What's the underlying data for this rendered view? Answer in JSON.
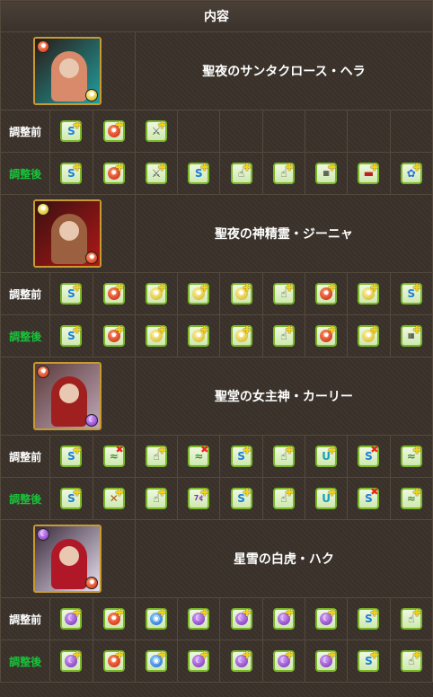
{
  "header": {
    "title": "内容"
  },
  "labels": {
    "before": "調整前",
    "after": "調整後"
  },
  "icon_legend": {
    "two-way": "two-way-attack-icon",
    "fire-orb": "fire-orb-enhance-icon",
    "light-orb": "light-orb-enhance-icon",
    "dark-orb": "dark-orb-enhance-icon",
    "water-orb": "water-orb-enhance-icon",
    "sword": "devil-killer-sword-icon",
    "finger": "time-extend-finger-icon",
    "skill": "skill-charge-icon",
    "bar": "bind-resist-icon",
    "heart": "heart-icon",
    "ribbon": "ribbon-icon",
    "shield": "combo-boost-icon",
    "wave": "seal-resist-icon",
    "slash": "resist-icon",
    "combo": "orb-count-icon"
  },
  "characters": [
    {
      "name": "聖夜のサンタクロース・ヘラ",
      "main_attr": "fire",
      "sub_attr": "light",
      "portrait_colors": [
        "#2a1a16",
        "#20a0a0",
        "#d88a6a"
      ],
      "before": [
        {
          "t": "two-way",
          "m": "plus"
        },
        {
          "t": "fire-orb",
          "m": "plus"
        },
        {
          "t": "sword",
          "m": "plus"
        }
      ],
      "after": [
        {
          "t": "two-way",
          "m": "plus"
        },
        {
          "t": "fire-orb",
          "m": "plus"
        },
        {
          "t": "sword",
          "m": "plus"
        },
        {
          "t": "two-way",
          "m": "plus"
        },
        {
          "t": "finger",
          "m": "plus"
        },
        {
          "t": "finger",
          "m": "plus"
        },
        {
          "t": "skill",
          "m": "plus"
        },
        {
          "t": "bar",
          "m": "plus"
        },
        {
          "t": "ribbon",
          "m": "plus"
        }
      ]
    },
    {
      "name": "聖夜の神精霊・ジーニャ",
      "main_attr": "light",
      "sub_attr": "fire",
      "portrait_colors": [
        "#3a1010",
        "#b01818",
        "#9a6040"
      ],
      "before": [
        {
          "t": "two-way",
          "m": "plus"
        },
        {
          "t": "fire-orb",
          "m": "plus"
        },
        {
          "t": "light-orb",
          "m": "plus"
        },
        {
          "t": "light-orb",
          "m": "plus"
        },
        {
          "t": "light-orb",
          "m": "plus"
        },
        {
          "t": "finger",
          "m": "plus"
        },
        {
          "t": "fire-orb",
          "m": "plus"
        },
        {
          "t": "light-orb",
          "m": "plus"
        },
        {
          "t": "two-way",
          "m": "plus"
        }
      ],
      "after": [
        {
          "t": "two-way",
          "m": "plus"
        },
        {
          "t": "fire-orb",
          "m": "plus"
        },
        {
          "t": "light-orb",
          "m": "plus"
        },
        {
          "t": "light-orb",
          "m": "plus"
        },
        {
          "t": "light-orb",
          "m": "plus"
        },
        {
          "t": "finger",
          "m": "plus"
        },
        {
          "t": "fire-orb",
          "m": "plus"
        },
        {
          "t": "light-orb",
          "m": "plus"
        },
        {
          "t": "skill",
          "m": "plus"
        }
      ]
    },
    {
      "name": "聖堂の女主神・カーリー",
      "main_attr": "fire",
      "sub_attr": "dark",
      "portrait_colors": [
        "#5a3a3a",
        "#c0a8b8",
        "#a02020"
      ],
      "before": [
        {
          "t": "two-way",
          "m": "plus"
        },
        {
          "t": "wave",
          "m": "x"
        },
        {
          "t": "finger",
          "m": "plus"
        },
        {
          "t": "wave",
          "m": "x"
        },
        {
          "t": "two-way",
          "m": "plus"
        },
        {
          "t": "finger",
          "m": "plus"
        },
        {
          "t": "shield",
          "m": "plus"
        },
        {
          "t": "two-way",
          "m": "x"
        },
        {
          "t": "wave",
          "m": "plus"
        }
      ],
      "after": [
        {
          "t": "two-way",
          "m": "plus"
        },
        {
          "t": "slash",
          "m": "plus"
        },
        {
          "t": "finger",
          "m": "plus"
        },
        {
          "t": "combo",
          "m": "plus"
        },
        {
          "t": "two-way",
          "m": "plus"
        },
        {
          "t": "finger",
          "m": "plus"
        },
        {
          "t": "shield",
          "m": "plus"
        },
        {
          "t": "two-way",
          "m": "x"
        },
        {
          "t": "wave",
          "m": "plus"
        }
      ]
    },
    {
      "name": "星雪の白虎・ハク",
      "main_attr": "dark",
      "sub_attr": "fire",
      "portrait_colors": [
        "#3a2a3a",
        "#e8e0f0",
        "#b01828"
      ],
      "before": [
        {
          "t": "dark-orb",
          "m": "plus"
        },
        {
          "t": "fire-orb",
          "m": "plus"
        },
        {
          "t": "water-orb",
          "m": "plus"
        },
        {
          "t": "dark-orb",
          "m": "plus"
        },
        {
          "t": "dark-orb",
          "m": "plus"
        },
        {
          "t": "dark-orb",
          "m": "plus"
        },
        {
          "t": "dark-orb",
          "m": "plus"
        },
        {
          "t": "two-way",
          "m": "plus"
        },
        {
          "t": "finger",
          "m": "plus"
        }
      ],
      "after": [
        {
          "t": "dark-orb",
          "m": "plus"
        },
        {
          "t": "fire-orb",
          "m": "plus"
        },
        {
          "t": "water-orb",
          "m": "plus"
        },
        {
          "t": "dark-orb",
          "m": "plus"
        },
        {
          "t": "dark-orb",
          "m": "plus"
        },
        {
          "t": "dark-orb",
          "m": "plus"
        },
        {
          "t": "dark-orb",
          "m": "plus"
        },
        {
          "t": "two-way",
          "m": "plus"
        },
        {
          "t": "finger",
          "m": "plus"
        }
      ]
    }
  ]
}
